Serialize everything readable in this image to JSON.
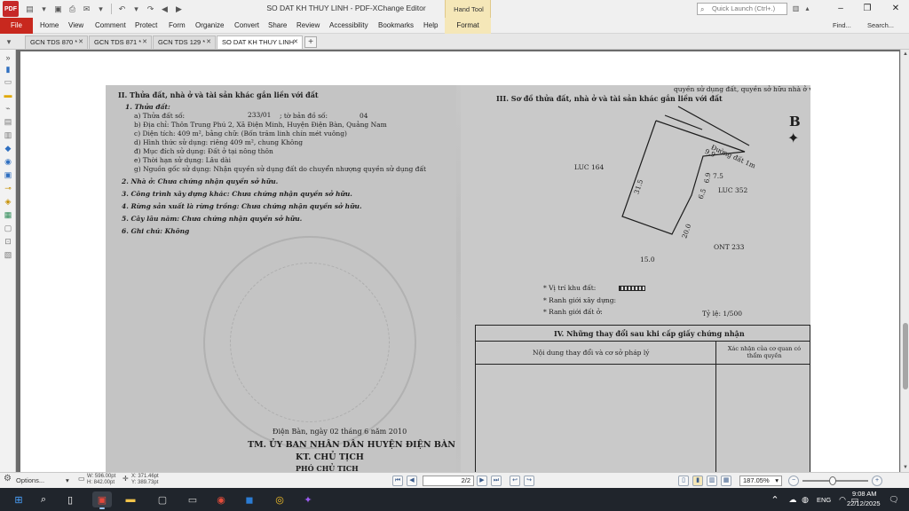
{
  "window": {
    "title": "SO DAT KH THUY LINH - PDF-XChange Editor",
    "app_icon_label": "PDF",
    "context_tab_group": "Hand Tool",
    "quick_launch_placeholder": "Quick Launch (Ctrl+.)"
  },
  "menu": {
    "file": "File",
    "items": [
      "Home",
      "View",
      "Comment",
      "Protect",
      "Form",
      "Organize",
      "Convert",
      "Share",
      "Review",
      "Accessibility",
      "Bookmarks",
      "Help"
    ],
    "format": "Format",
    "find": "Find...",
    "search": "Search..."
  },
  "tabs": [
    {
      "label": "GCN TDS 870 *",
      "active": false
    },
    {
      "label": "GCN TDS 871 *",
      "active": false
    },
    {
      "label": "GCN TDS 129 *",
      "active": false
    },
    {
      "label": "SO DAT KH THUY LINH",
      "active": true
    }
  ],
  "document": {
    "section2_title": "II. Thửa đất, nhà ở và tài sản khác gắn liền với đất",
    "land_heading": "1. Thửa đất:",
    "parcel_label": "a) Thửa đất số:",
    "parcel_no": "233/01",
    "map_label": "; tờ bản đồ số:",
    "map_no": "04",
    "address": "b) Địa chỉ:  Thôn Trung Phú 2, Xã Điện Minh, Huyện Điện Bàn, Quảng Nam",
    "area": "c) Diện tích: 409    m², bằng chữ: (Bốn trăm linh chín mét vuông)",
    "usage_form": "d) Hình thức sử dụng: riêng   409   m², chung   Không",
    "purpose": "đ) Mục đích sử dụng: Đất ở tại nông thôn",
    "term": "e) Thời hạn sử dụng:            Lâu dài",
    "origin": "g) Nguồn gốc sử dụng: Nhận quyền sử dụng đất do chuyển nhượng quyền sử dụng đất",
    "house": "2. Nhà ở:  Chưa chứng nhận quyền sở hữu.",
    "construction": "3. Công trình xây dựng khác: Chưa chứng nhận quyền sở hữu.",
    "forest": "4. Rừng sản xuất là rừng trồng: Chưa chứng nhận quyền sở hữu.",
    "perennial": "5. Cây lâu năm: Chưa chứng nhận quyền sở hữu.",
    "note": "6. Ghi chú: Không",
    "section3_title": "III. Sơ đồ thửa đất, nhà ở và tài sản khác gắn liền với đất",
    "top_right_fragment": "quyền sử dụng đất, quyền sở hữu nhà ở và tài sản khác gắn liền với đất",
    "north": "B",
    "parcels": {
      "luc164": "LUC 164",
      "luc352": "LUC 352",
      "ont233": "ONT 233",
      "road": "Đường đất 1m"
    },
    "dims": {
      "d99": "9.9",
      "d315": "31.5",
      "d69": "6.9",
      "d75": "7.5",
      "d65": "6.5",
      "d200": "20.0",
      "d150": "15.0"
    },
    "legend_location": "* Vị trí khu đất:",
    "legend_construction": "* Ranh giới xây dựng:",
    "legend_residential": "* Ranh giới đất ở:",
    "scale": "Tỷ lệ: 1/500",
    "section4_title": "IV. Những thay đổi sau khi cấp giấy chứng nhận",
    "col1_header": "Nội dung thay đổi và cơ sở pháp lý",
    "col2_header": "Xác nhận của cơ quan có thẩm quyền",
    "date_line": "Điện Bàn, ngày 02 tháng 6 năm 2010",
    "authority": "TM. ỦY BAN NHÂN DÂN HUYỆN ĐIỆN BÀN",
    "kt_chairman": "KT. CHỦ TỊCH",
    "vice_chairman": "PHÓ CHỦ TỊCH"
  },
  "statusbar": {
    "options": "Options...",
    "width": "W: 596.00pt",
    "height": "H: 842.00pt",
    "x": "X: 371.46pt",
    "y": "Y: 389.73pt",
    "page": "2/2",
    "zoom": "187.05%"
  },
  "taskbar": {
    "lang": "ENG",
    "time": "9:08 AM",
    "date": "22/12/2025"
  },
  "colors": {
    "file_red": "#c8281e",
    "context_tab": "#f5e7b8",
    "taskbar": "#20252c"
  }
}
